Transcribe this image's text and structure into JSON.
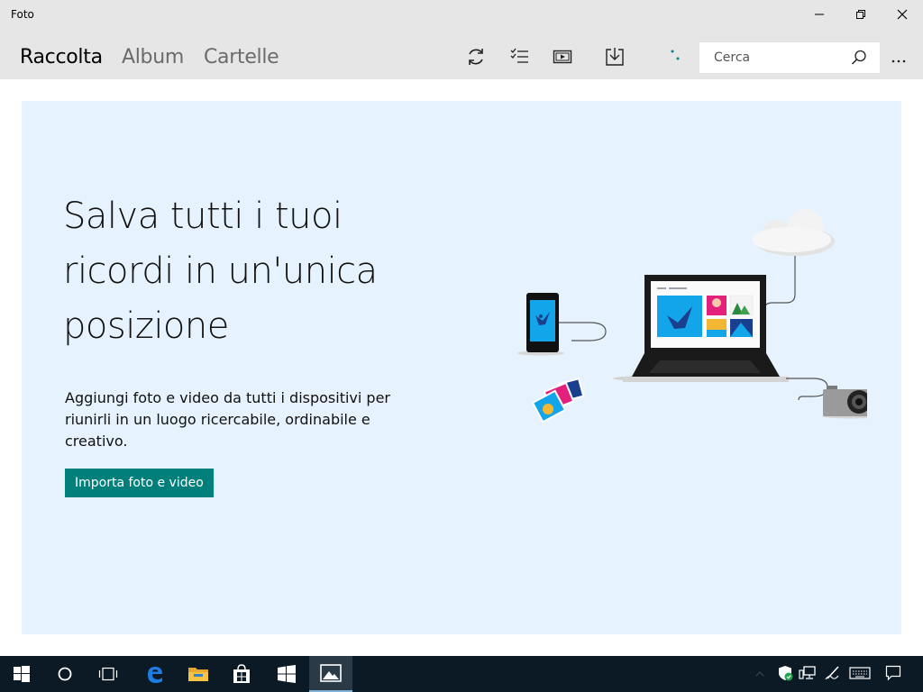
{
  "window": {
    "title": "Foto"
  },
  "nav": {
    "tabs": [
      {
        "label": "Raccolta",
        "active": true
      },
      {
        "label": "Album",
        "active": false
      },
      {
        "label": "Cartelle",
        "active": false
      }
    ]
  },
  "toolbar": {
    "icons": [
      "refresh-icon",
      "select-icon",
      "slideshow-icon",
      "import-icon",
      "loading-icon"
    ]
  },
  "search": {
    "placeholder": "Cerca"
  },
  "hero": {
    "headline": "Salva tutti i tuoi ricordi in un'unica posizione",
    "description": "Aggiungi foto e video da tutti i dispositivi per riunirli in un luogo ricercabile, ordinabile e creativo.",
    "cta_label": "Importa foto e video"
  },
  "taskbar": {
    "items": [
      "start-icon",
      "search-icon",
      "task-view-icon",
      "edge-icon",
      "file-explorer-icon",
      "store-icon",
      "windows-logo-icon",
      "photos-icon"
    ],
    "active_item": "photos-icon",
    "tray": [
      "defender-icon",
      "network-icon",
      "pen-icon",
      "keyboard-icon",
      "notifications-icon"
    ]
  },
  "colors": {
    "chrome": "#e6e6e6",
    "hero_bg": "#e6f2fd",
    "accent": "#007f7b",
    "taskbar": "#0b1a24"
  }
}
